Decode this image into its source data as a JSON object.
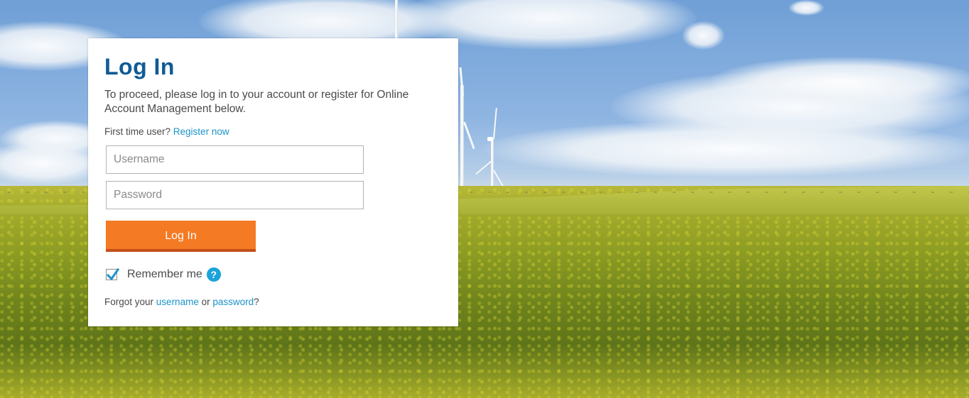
{
  "login": {
    "title": "Log In",
    "intro": "To proceed, please log in to your account or register for Online Account Management below.",
    "first_time_prefix": "First time user?",
    "register_link": "Register now",
    "username_placeholder": "Username",
    "username_value": "",
    "password_placeholder": "Password",
    "password_value": "",
    "submit_label": "Log In",
    "remember_label": "Remember me",
    "remember_checked": true,
    "help_icon_glyph": "?",
    "forgot_prefix": "Forgot your",
    "forgot_username_link": "username",
    "forgot_or": "or",
    "forgot_password_link": "password",
    "forgot_suffix": "?"
  },
  "colors": {
    "title": "#0f5b96",
    "link": "#1a93c8",
    "button": "#f47a23",
    "button_shadow": "#c4501a",
    "checkmark": "#1a93c8",
    "help_icon": "#1aa3dc"
  },
  "icons": {
    "checkbox": "checkmark-icon",
    "help": "question-circle-icon"
  }
}
